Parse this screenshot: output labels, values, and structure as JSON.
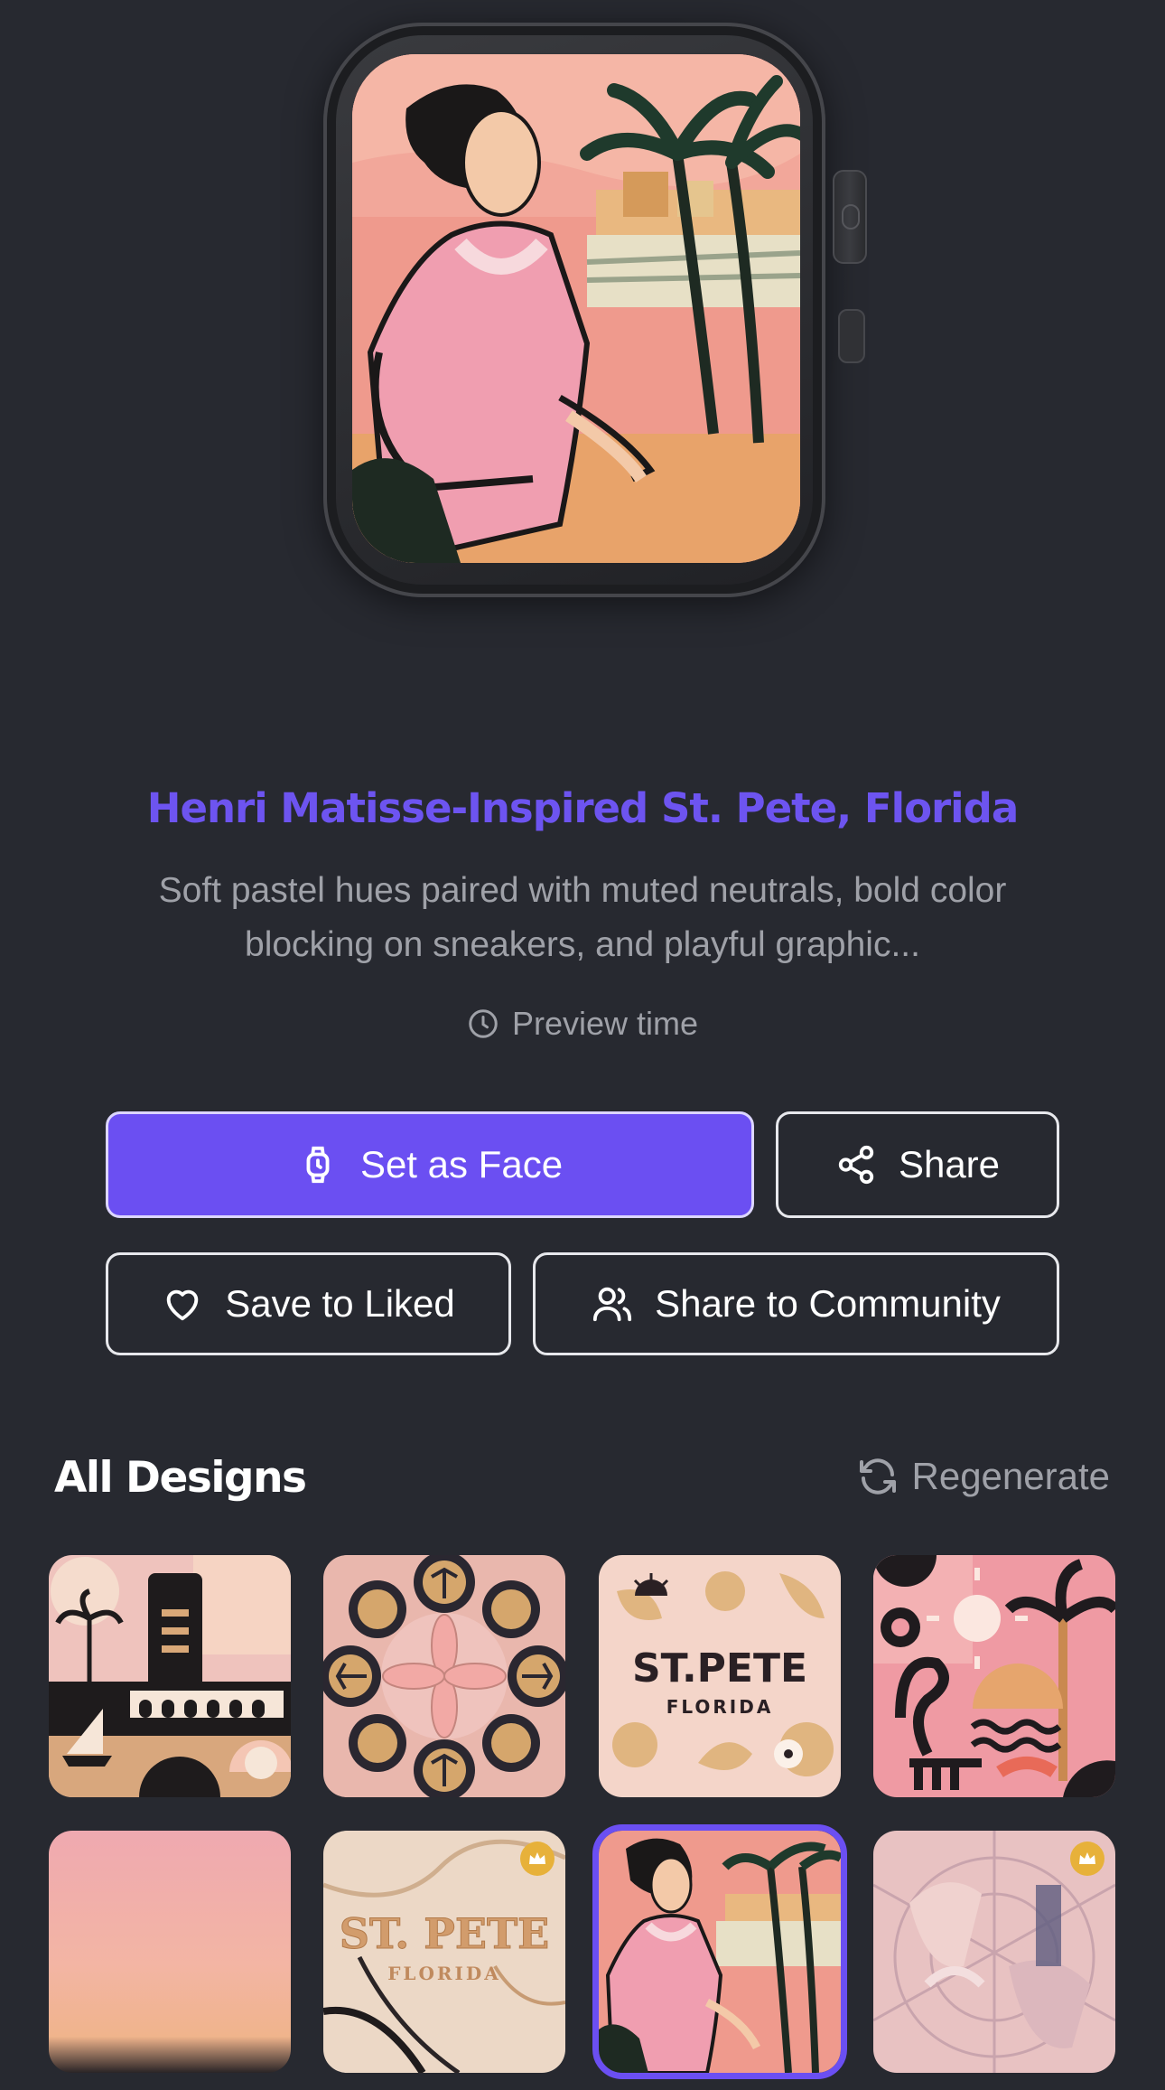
{
  "design": {
    "title": "Henri Matisse-Inspired St. Pete, Florida",
    "description": "Soft pastel hues paired with muted neutrals, bold color blocking on sneakers, and playful graphic...",
    "preview_label": "Preview time"
  },
  "actions": {
    "set_face": "Set as Face",
    "share": "Share",
    "save_liked": "Save to Liked",
    "share_community": "Share to Community"
  },
  "section": {
    "title": "All Designs",
    "regenerate": "Regenerate"
  },
  "tiles": [
    {
      "name": "design-tile-geometric-skyline",
      "premium": false,
      "selected": false
    },
    {
      "name": "design-tile-kaleidoscope",
      "premium": false,
      "selected": false
    },
    {
      "name": "design-tile-st-pete-typography",
      "premium": false,
      "selected": false,
      "text_top": "ST.PETE",
      "text_bottom": "FLORIDA"
    },
    {
      "name": "design-tile-flamingo-collage",
      "premium": false,
      "selected": false
    },
    {
      "name": "design-tile-sunset-gradient",
      "premium": false,
      "selected": false
    },
    {
      "name": "design-tile-marble-st-pete",
      "premium": true,
      "selected": false,
      "text_top": "ST. PETE",
      "text_bottom": "FLORIDA"
    },
    {
      "name": "design-tile-matisse-woman",
      "premium": false,
      "selected": true
    },
    {
      "name": "design-tile-stained-glass",
      "premium": true,
      "selected": false
    }
  ],
  "colors": {
    "accent": "#6b4ff2",
    "title": "#6d54f0",
    "background": "#272930",
    "muted_text": "#9fa1a8",
    "premium": "#e7b13a"
  }
}
